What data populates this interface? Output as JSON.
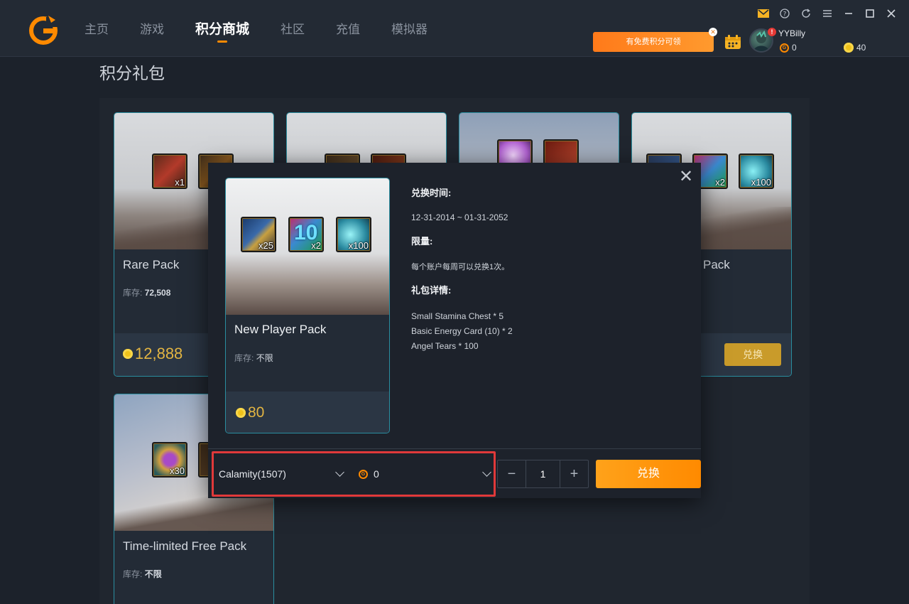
{
  "nav": {
    "items": [
      {
        "label": "主页"
      },
      {
        "label": "游戏"
      },
      {
        "label": "积分商城",
        "active": true
      },
      {
        "label": "社区"
      },
      {
        "label": "充值"
      },
      {
        "label": "模拟器"
      }
    ]
  },
  "header": {
    "promo_label": "有免费积分可领",
    "avatar_badge": "!",
    "username": "YYBilly",
    "gcoin_balance": "0",
    "points_balance": "40",
    "accent_color": "#ff8a00"
  },
  "page": {
    "title": "积分礼包"
  },
  "cards": [
    {
      "name": "Rare Pack",
      "stock_label": "库存:",
      "stock": "72,508",
      "price": "12,888",
      "redeem_label": "",
      "items": [
        {
          "icon": "treasure-chest-icon",
          "qty": "x1"
        },
        {
          "icon": "rune-item-icon",
          "qty": ""
        }
      ]
    },
    {
      "name": "",
      "stock_label": "",
      "stock": "",
      "price": "",
      "redeem_label": "",
      "items": [
        {
          "icon": "bow-item-icon",
          "qty": ""
        },
        {
          "icon": "scroll-item-icon",
          "qty": ""
        }
      ]
    },
    {
      "name": "",
      "stock_label": "",
      "stock": "",
      "price": "",
      "redeem_label": "",
      "items": [
        {
          "icon": "orb-item-icon",
          "qty": ""
        },
        {
          "icon": "card-item-icon",
          "qty": ""
        }
      ]
    },
    {
      "name": "Pack",
      "stock_label": "",
      "stock": "",
      "price": "",
      "redeem_label": "兑换",
      "items": [
        {
          "icon": "stamina-chest-icon",
          "qty": ""
        },
        {
          "icon": "energy-card-icon",
          "qty": "x2"
        },
        {
          "icon": "angel-tears-icon",
          "qty": "x100"
        }
      ]
    },
    {
      "name": "Time-limited Free Pack",
      "stock_label": "库存:",
      "stock": "不限",
      "price": "",
      "redeem_label": "",
      "items": [
        {
          "icon": "magic-pouch-icon",
          "qty": "x30"
        }
      ]
    }
  ],
  "modal": {
    "pack_name": "New Player Pack",
    "stock_label": "库存:",
    "stock": "不限",
    "price": "80",
    "items": [
      {
        "icon": "stamina-chest-icon",
        "qty": "x25"
      },
      {
        "icon": "energy-card-icon",
        "qty": "x2",
        "badge": "10"
      },
      {
        "icon": "angel-tears-icon",
        "qty": "x100"
      }
    ],
    "time_label": "兑换时间:",
    "time_value": "12-31-2014 ~ 01-31-2052",
    "limit_label": "限量:",
    "limit_value": "每个账户每周可以兑换1次。",
    "details_label": "礼包详情:",
    "details_list": [
      "Small Stamina Chest * 5",
      "Basic Energy Card (10) * 2",
      "Angel Tears * 100"
    ],
    "server": "Calamity(1507)",
    "role_gcoin": "0",
    "quantity": "1",
    "minus": "−",
    "plus": "+",
    "exchange_label": "兑换"
  }
}
